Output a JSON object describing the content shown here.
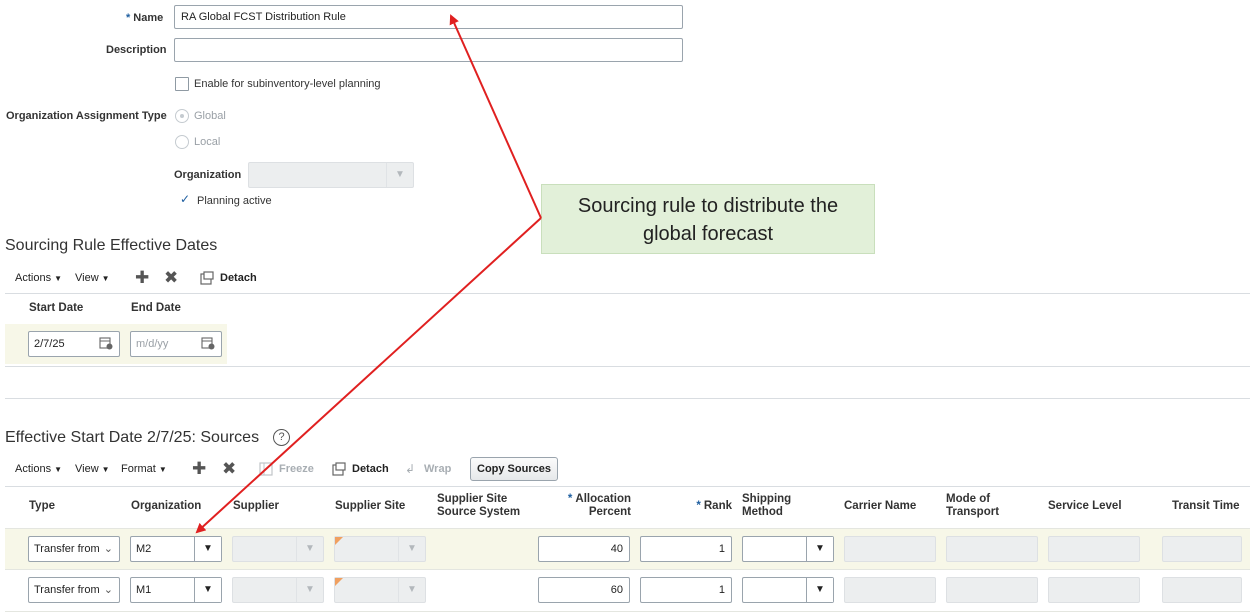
{
  "form": {
    "name_label": "Name",
    "name_value": "RA Global FCST Distribution Rule",
    "description_label": "Description",
    "description_value": "",
    "subinventory_label": "Enable for subinventory-level planning",
    "org_assign_label": "Organization Assignment Type",
    "global_label": "Global",
    "local_label": "Local",
    "organization_label": "Organization",
    "organization_value": "",
    "planning_active_label": "Planning active"
  },
  "callout": {
    "line1": "Sourcing rule to distribute the",
    "line2": "global forecast"
  },
  "dates_section": {
    "title": "Sourcing Rule Effective Dates",
    "toolbar": {
      "actions": "Actions",
      "view": "View",
      "detach": "Detach"
    },
    "headers": {
      "start_date": "Start Date",
      "end_date": "End Date"
    },
    "row": {
      "start_date": "2/7/25",
      "end_date_placeholder": "m/d/yy"
    }
  },
  "sources_section": {
    "title": "Effective Start Date 2/7/25: Sources",
    "help_icon_glyph": "?",
    "toolbar": {
      "actions": "Actions",
      "view": "View",
      "format": "Format",
      "freeze": "Freeze",
      "detach": "Detach",
      "wrap": "Wrap",
      "copy_sources": "Copy Sources"
    },
    "headers": {
      "type": "Type",
      "organization": "Organization",
      "supplier": "Supplier",
      "supplier_site": "Supplier Site",
      "supplier_site_source_system_1": "Supplier Site",
      "supplier_site_source_system_2": "Source System",
      "allocation_percent_1": "Allocation",
      "allocation_percent_2": "Percent",
      "rank": "Rank",
      "shipping_method_1": "Shipping",
      "shipping_method_2": "Method",
      "carrier_name": "Carrier Name",
      "mode_of_transport_1": "Mode of",
      "mode_of_transport_2": "Transport",
      "service_level": "Service Level",
      "transit_time": "Transit Time"
    },
    "rows": [
      {
        "type": "Transfer from",
        "organization": "M2",
        "allocation_percent": "40",
        "rank": "1"
      },
      {
        "type": "Transfer from",
        "organization": "M1",
        "allocation_percent": "60",
        "rank": "1"
      }
    ]
  },
  "colors": {
    "row_highlight": "#f7f7e8",
    "callout_bg": "#e2f0d9",
    "arrow": "#e02020",
    "required_star": "#1f5fa0"
  }
}
